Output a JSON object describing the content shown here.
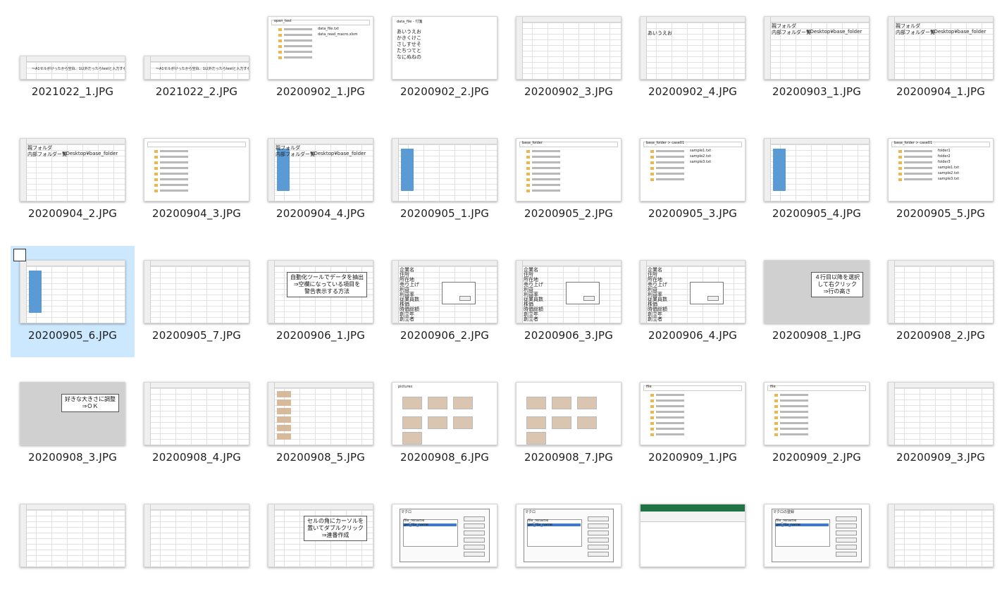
{
  "window": {
    "view": "large-icons"
  },
  "colors": {
    "selection": "#cce8ff",
    "mask": "#5b9bd5",
    "excel_green": "#217346"
  },
  "selected_index": 16,
  "files": [
    {
      "name": "2021022_1.JPG",
      "kind": "sheet",
      "short": true,
      "text": "〜A1セルがけったから空白、1以外だったらtestと入力する"
    },
    {
      "name": "2021022_2.JPG",
      "kind": "sheet",
      "short": true,
      "text": "〜A1セルがけったから空白、1以外だったらtestと入力する"
    },
    {
      "name": "20200902_1.JPG",
      "kind": "explorer",
      "title": "open_test",
      "items": [
        "data_file.txt",
        "data_read_macro.xlsm"
      ]
    },
    {
      "name": "20200902_2.JPG",
      "kind": "text",
      "title": "data_file - 付箋",
      "lines": [
        "あいうえお",
        "かきくけこ",
        "さしすせそ",
        "たちつてと",
        "なにぬねの"
      ]
    },
    {
      "name": "20200902_3.JPG",
      "kind": "sheet"
    },
    {
      "name": "20200902_4.JPG",
      "kind": "sheet",
      "cell": "あいうえお"
    },
    {
      "name": "20200903_1.JPG",
      "kind": "sheet",
      "labels": [
        "親フォルダ",
        "内部フォルダー覧"
      ],
      "path": "¥Desktop¥base_folder"
    },
    {
      "name": "20200904_1.JPG",
      "kind": "sheet",
      "labels": [
        "親フォルダ",
        "内部フォルダー覧"
      ],
      "path": "¥Desktop¥base_folder"
    },
    {
      "name": "20200904_2.JPG",
      "kind": "sheet",
      "labels": [
        "親フォルダ",
        "内部フォルダー覧"
      ],
      "path": "¥Desktop¥base_folder"
    },
    {
      "name": "20200904_3.JPG",
      "kind": "explorer"
    },
    {
      "name": "20200904_4.JPG",
      "kind": "sheet",
      "mask": true,
      "labels": [
        "親フォルダ",
        "内部フォルダー覧"
      ],
      "path": "¥Desktop¥base_folder"
    },
    {
      "name": "20200905_1.JPG",
      "kind": "sheet",
      "mask": true
    },
    {
      "name": "20200905_2.JPG",
      "kind": "explorer",
      "title": "base_folder"
    },
    {
      "name": "20200905_3.JPG",
      "kind": "explorer",
      "title": "base_folder > case01",
      "items": [
        "sample1.txt",
        "sample2.txt",
        "sample3.txt"
      ]
    },
    {
      "name": "20200905_4.JPG",
      "kind": "sheet",
      "mask": true
    },
    {
      "name": "20200905_5.JPG",
      "kind": "explorer",
      "title": "base_folder > case01",
      "items": [
        "folder1",
        "folder2",
        "folder3",
        "sample1.txt",
        "sample2.txt",
        "sample3.txt"
      ]
    },
    {
      "name": "20200905_6.JPG",
      "kind": "sheet",
      "mask": true
    },
    {
      "name": "20200905_7.JPG",
      "kind": "sheet"
    },
    {
      "name": "20200906_1.JPG",
      "kind": "sheet",
      "callout": "自動化ツールでデータを抽出\n⇒空欄になっている項目を\n警告表示する方法"
    },
    {
      "name": "20200906_2.JPG",
      "kind": "dialog-sheet",
      "labels": [
        "企業名",
        "住所",
        "所在地",
        "売り上げ",
        "利益",
        "利益率",
        "従業員数",
        "株価",
        "時価総額",
        "創立年",
        "創立者"
      ]
    },
    {
      "name": "20200906_3.JPG",
      "kind": "dialog-sheet",
      "labels": [
        "企業名",
        "住所",
        "所在地",
        "売り上げ",
        "利益",
        "利益率",
        "従業員数",
        "株価",
        "時価総額",
        "創立年",
        "創立者"
      ]
    },
    {
      "name": "20200906_4.JPG",
      "kind": "dialog-sheet",
      "labels": [
        "企業名",
        "住所",
        "所在地",
        "売り上げ",
        "利益",
        "利益率",
        "従業員数",
        "株価",
        "時価総額",
        "創立年",
        "創立者"
      ]
    },
    {
      "name": "20200908_1.JPG",
      "kind": "gray",
      "callout": "４行目以降を選択\nして右クリック\n⇒行の高さ"
    },
    {
      "name": "20200908_2.JPG",
      "kind": "sheet"
    },
    {
      "name": "20200908_3.JPG",
      "kind": "gray",
      "callout": "好きな大きさに調整\n⇒ＯＫ"
    },
    {
      "name": "20200908_4.JPG",
      "kind": "sheet"
    },
    {
      "name": "20200908_5.JPG",
      "kind": "photos-sheet"
    },
    {
      "name": "20200908_6.JPG",
      "kind": "photos",
      "title": "pictures"
    },
    {
      "name": "20200908_7.JPG",
      "kind": "photos"
    },
    {
      "name": "20200909_1.JPG",
      "kind": "explorer",
      "title": "file"
    },
    {
      "name": "20200909_2.JPG",
      "kind": "explorer",
      "title": "file"
    },
    {
      "name": "20200909_3.JPG",
      "kind": "sheet"
    },
    {
      "name": "",
      "kind": "sheet"
    },
    {
      "name": "",
      "kind": "sheet"
    },
    {
      "name": "",
      "kind": "sheet",
      "callout": "セルの角にカーソルを\n置いてダブルクリック\n⇒連番作成"
    },
    {
      "name": "",
      "kind": "dialog",
      "title": "マクロ",
      "items": [
        "file_rename",
        "get_file_name"
      ]
    },
    {
      "name": "",
      "kind": "dialog",
      "title": "マクロ",
      "items": [
        "file_rename",
        "get_file_name"
      ]
    },
    {
      "name": "",
      "kind": "ribbon"
    },
    {
      "name": "",
      "kind": "dialog",
      "title": "マクロの登録",
      "items": [
        "file_rename",
        "get_file_name"
      ]
    },
    {
      "name": "",
      "kind": "sheet"
    }
  ]
}
